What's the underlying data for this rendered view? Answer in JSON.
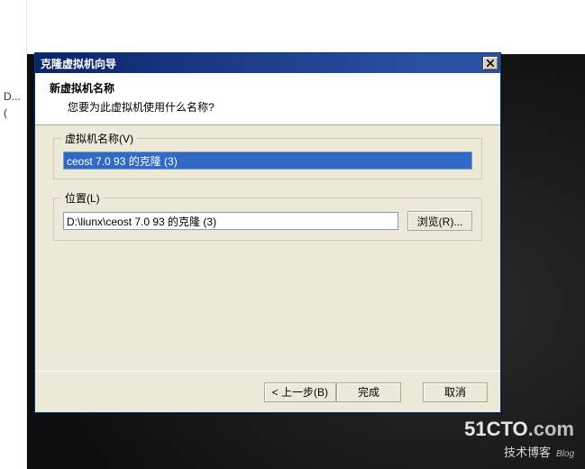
{
  "left_panel": {
    "item": "D..."
  },
  "dialog": {
    "title": "克隆虚拟机向导",
    "header": {
      "title": "新虚拟机名称",
      "subtitle": "您要为此虚拟机使用什么名称?"
    },
    "name_group": {
      "label": "虚拟机名称(V)",
      "value": "ceost 7.0 93 的克隆 (3)"
    },
    "location_group": {
      "label": "位置(L)",
      "value": "D:\\liunx\\ceost 7.0 93 的克隆 (3)",
      "browse": "浏览(R)..."
    },
    "footer": {
      "back": "< 上一步(B)",
      "finish": "完成",
      "cancel": "取消"
    }
  },
  "watermark": {
    "brand1": "51CTO",
    "brand2": ".com",
    "sub": "技术博客",
    "blog": "Blog"
  }
}
